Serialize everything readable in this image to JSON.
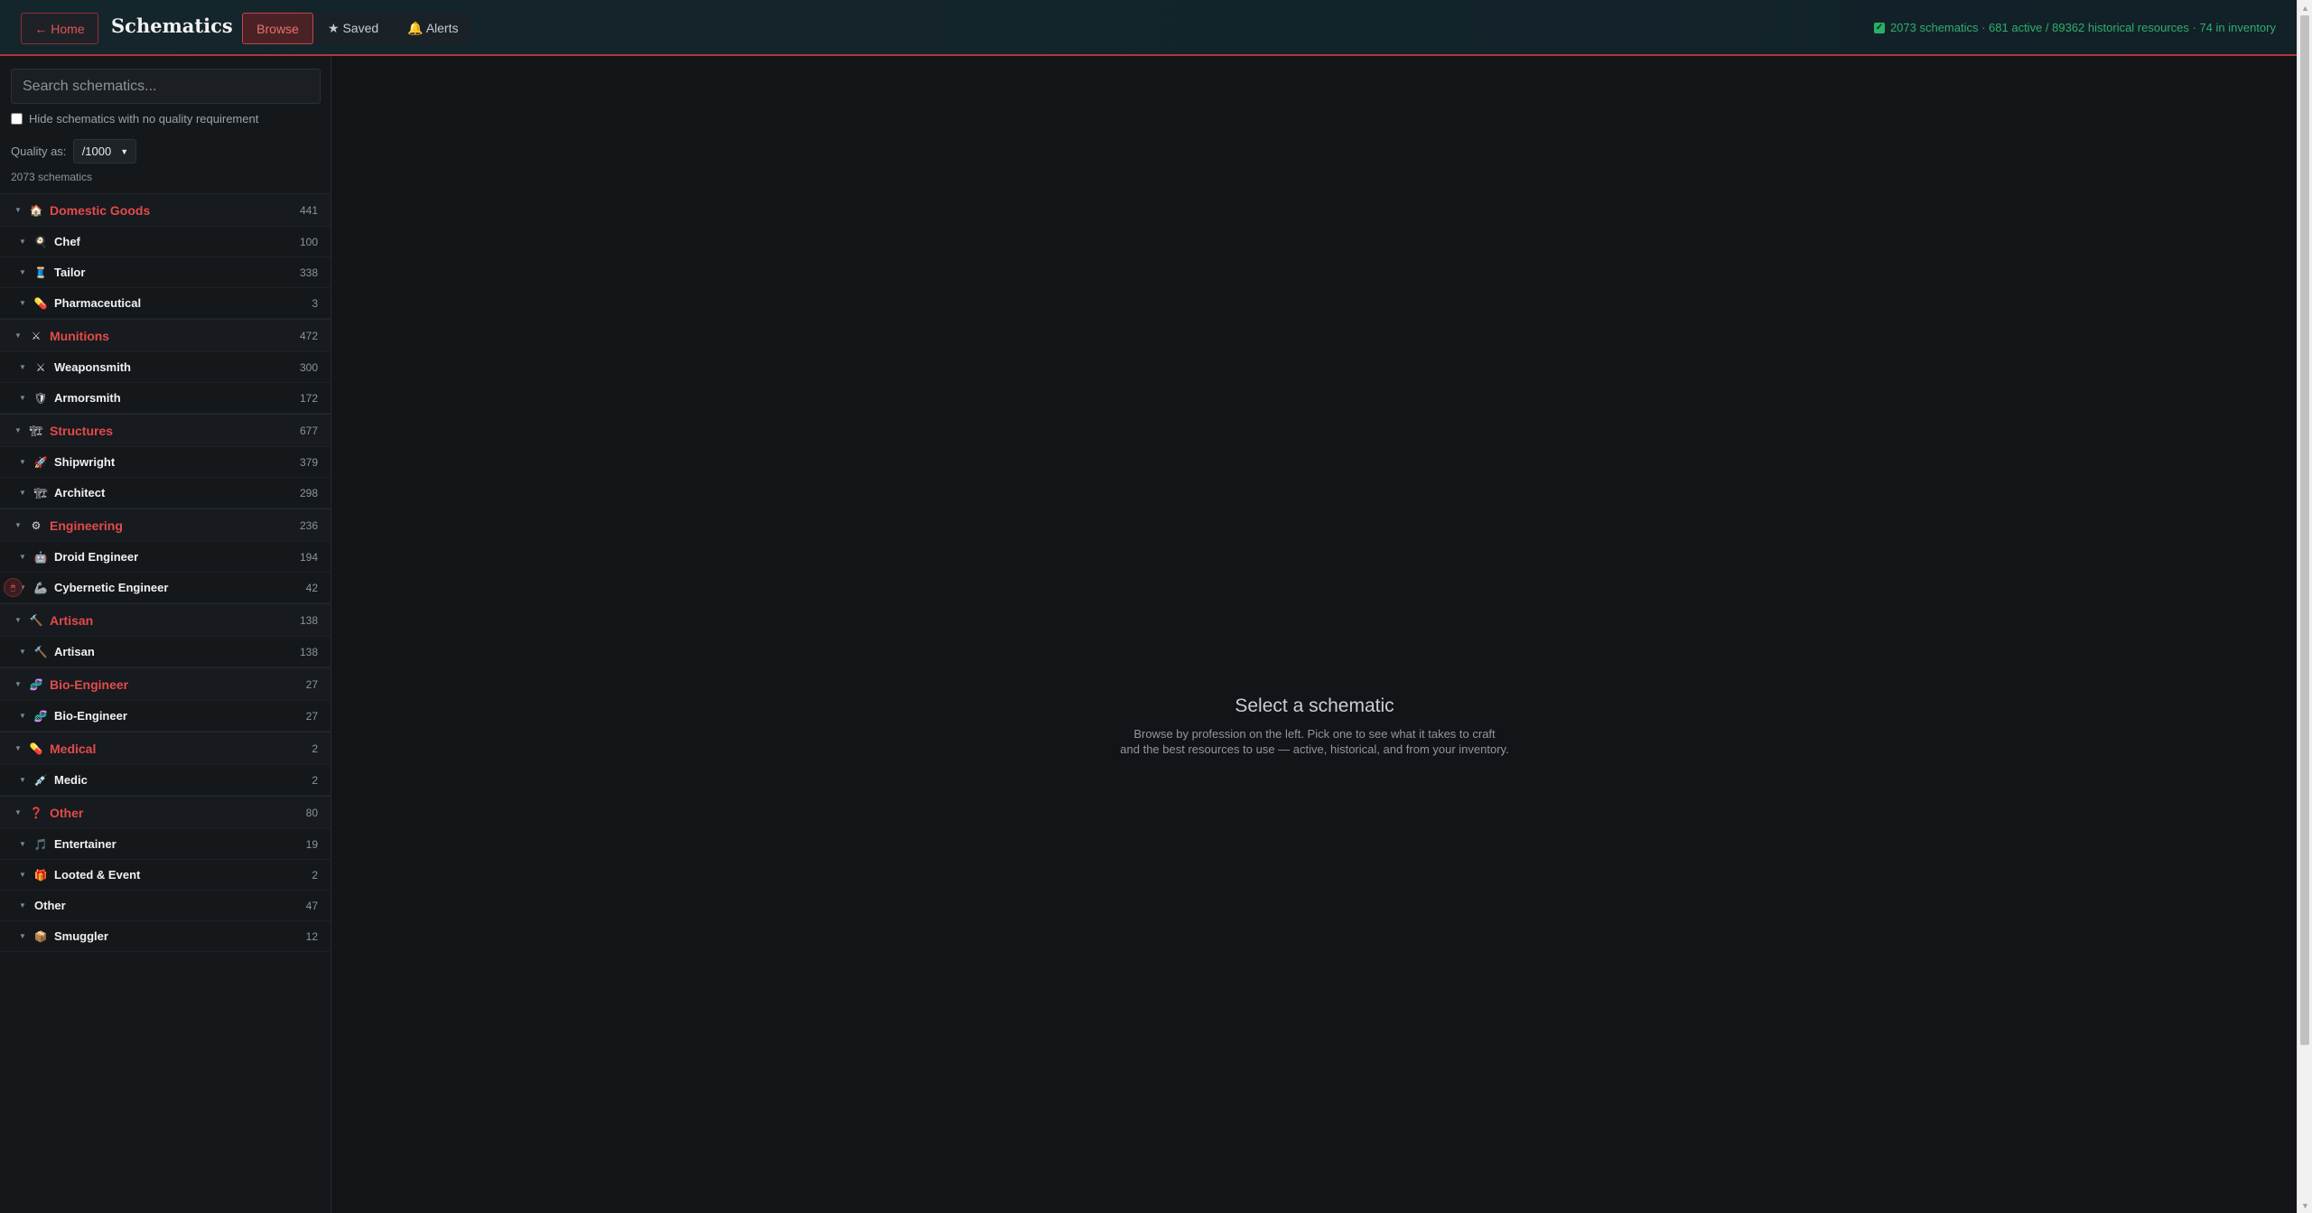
{
  "header": {
    "home_label": "← Home",
    "title": "Schematics",
    "tabs": [
      {
        "label": "Browse",
        "active": true
      },
      {
        "label": "★ Saved",
        "active": false
      },
      {
        "label": "🔔 Alerts",
        "active": false
      }
    ],
    "status": "2073 schematics · 681 active / 89362 historical resources · 74 in inventory",
    "status_icon": "check-icon"
  },
  "sidebar": {
    "search_placeholder": "Search schematics...",
    "hide_label": "Hide schematics with no quality requirement",
    "hide_checked": false,
    "quality_label": "Quality as:",
    "quality_value": "/1000",
    "count_label": "2073 schematics",
    "tree": [
      {
        "type": "cat",
        "icon": "🏠",
        "icon_name": "house-icon",
        "label": "Domestic Goods",
        "count": "441"
      },
      {
        "type": "prof",
        "icon": "🍳",
        "icon_name": "chef-icon",
        "label": "Chef",
        "count": "100"
      },
      {
        "type": "prof",
        "icon": "🧵",
        "icon_name": "thread-icon",
        "label": "Tailor",
        "count": "338"
      },
      {
        "type": "prof",
        "icon": "💊",
        "icon_name": "pill-icon",
        "label": "Pharmaceutical",
        "count": "3"
      },
      {
        "type": "cat",
        "icon": "⚔",
        "icon_name": "crossed-swords-icon",
        "label": "Munitions",
        "count": "472"
      },
      {
        "type": "prof",
        "icon": "⚔",
        "icon_name": "crossed-swords-icon",
        "label": "Weaponsmith",
        "count": "300"
      },
      {
        "type": "prof",
        "icon": "🛡",
        "icon_name": "shield-icon",
        "label": "Armorsmith",
        "count": "172"
      },
      {
        "type": "cat",
        "icon": "🏗",
        "icon_name": "construction-icon",
        "label": "Structures",
        "count": "677"
      },
      {
        "type": "prof",
        "icon": "🚀",
        "icon_name": "rocket-icon",
        "label": "Shipwright",
        "count": "379"
      },
      {
        "type": "prof",
        "icon": "🏗",
        "icon_name": "construction-icon",
        "label": "Architect",
        "count": "298"
      },
      {
        "type": "cat",
        "icon": "⚙",
        "icon_name": "gear-icon",
        "label": "Engineering",
        "count": "236"
      },
      {
        "type": "prof",
        "icon": "🤖",
        "icon_name": "robot-icon",
        "label": "Droid Engineer",
        "count": "194"
      },
      {
        "type": "prof",
        "icon": "🦾",
        "icon_name": "mechanical-arm-icon",
        "label": "Cybernetic Engineer",
        "count": "42"
      },
      {
        "type": "cat",
        "icon": "🔨",
        "icon_name": "hammer-icon",
        "label": "Artisan",
        "count": "138"
      },
      {
        "type": "prof",
        "icon": "🔨",
        "icon_name": "hammer-icon",
        "label": "Artisan",
        "count": "138"
      },
      {
        "type": "cat",
        "icon": "🧬",
        "icon_name": "dna-icon",
        "label": "Bio-Engineer",
        "count": "27"
      },
      {
        "type": "prof",
        "icon": "🧬",
        "icon_name": "dna-icon",
        "label": "Bio-Engineer",
        "count": "27"
      },
      {
        "type": "cat",
        "icon": "💊",
        "icon_name": "pill-icon",
        "label": "Medical",
        "count": "2"
      },
      {
        "type": "prof",
        "icon": "💉",
        "icon_name": "syringe-icon",
        "label": "Medic",
        "count": "2"
      },
      {
        "type": "cat",
        "icon": "❓",
        "icon_name": "question-icon",
        "label": "Other",
        "count": "80"
      },
      {
        "type": "prof",
        "icon": "🎵",
        "icon_name": "music-icon",
        "label": "Entertainer",
        "count": "19"
      },
      {
        "type": "prof",
        "icon": "🎁",
        "icon_name": "gift-icon",
        "label": "Looted & Event",
        "count": "2"
      },
      {
        "type": "prof",
        "icon": "",
        "icon_name": "",
        "label": "Other",
        "count": "47"
      },
      {
        "type": "prof",
        "icon": "📦",
        "icon_name": "package-icon",
        "label": "Smuggler",
        "count": "12"
      }
    ]
  },
  "main": {
    "empty_title": "Select a schematic",
    "empty_desc_line1": "Browse by profession on the left. Pick one to see what it takes to craft",
    "empty_desc_line2": "and the best resources to use — active, historical, and from your inventory."
  },
  "colors": {
    "accent": "#e24b4b",
    "status": "#2fae6c",
    "background": "#121417"
  }
}
